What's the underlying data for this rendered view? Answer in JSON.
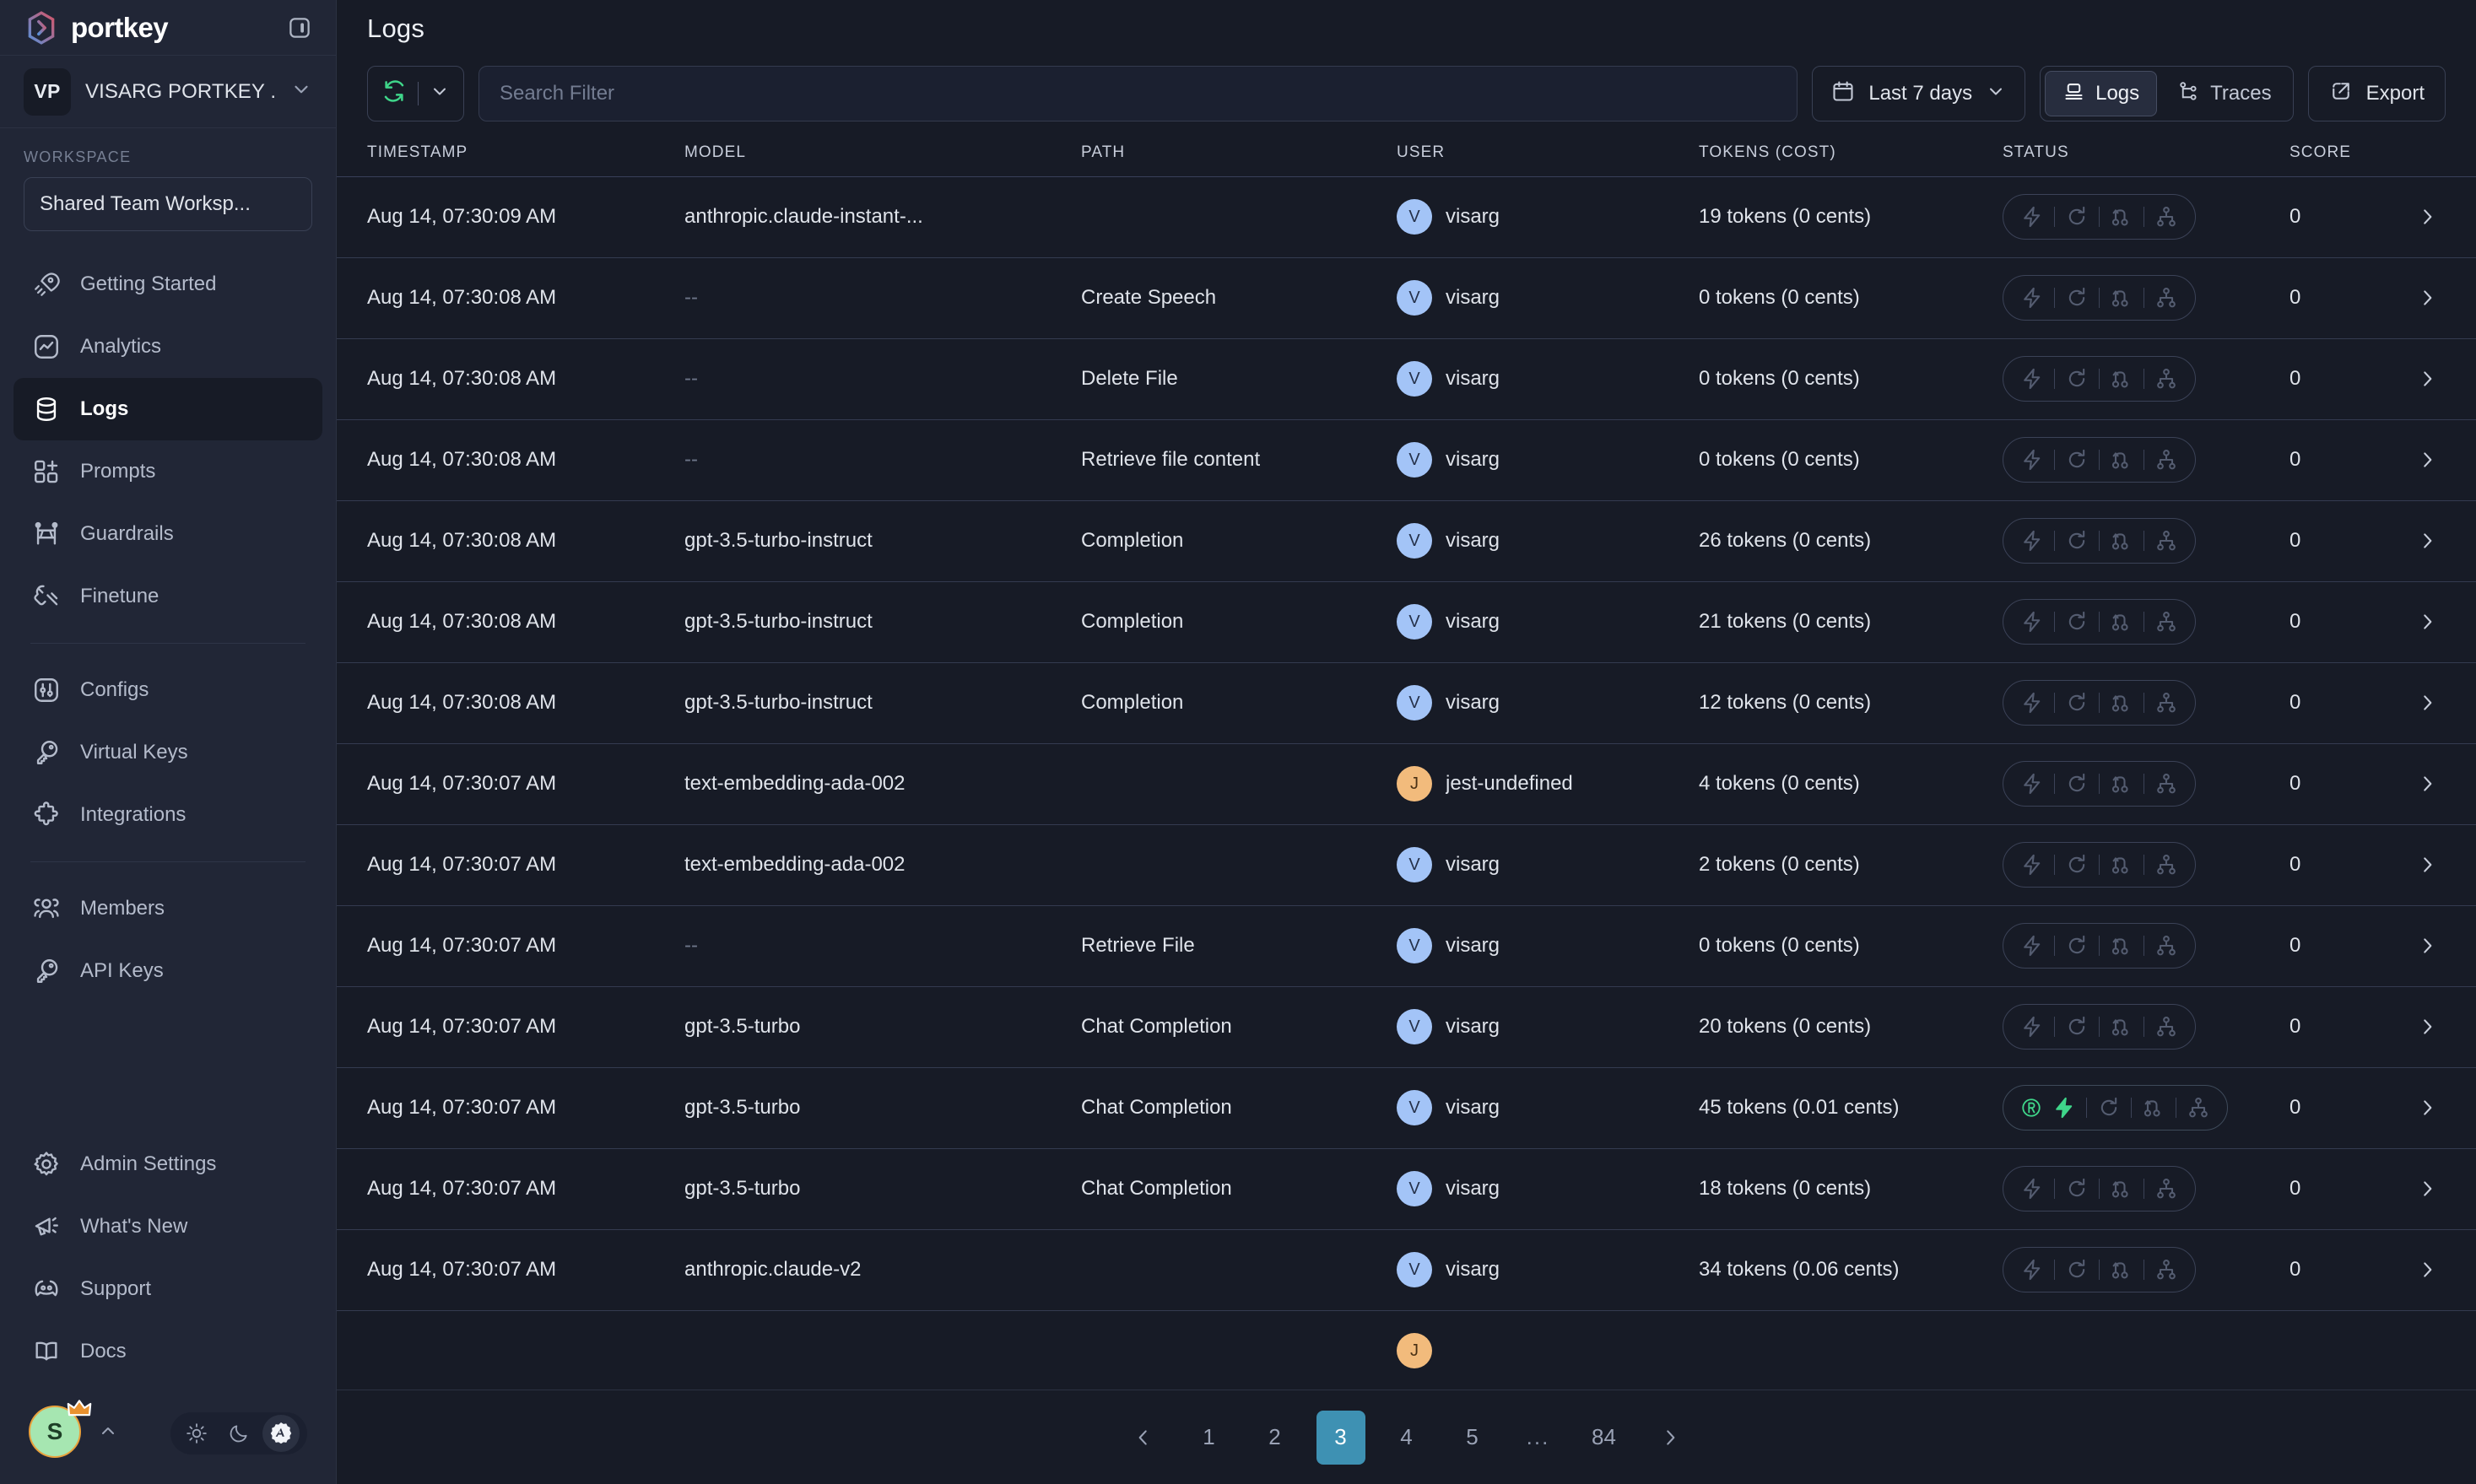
{
  "brand": {
    "name": "portkey",
    "collapse_icon": "panel-collapse-icon"
  },
  "org": {
    "initials": "VP",
    "name": "VISARG PORTKEY ...",
    "caret_icon": "chevron-down-icon"
  },
  "workspace": {
    "label": "WORKSPACE",
    "selected": "Shared Team Worksp...",
    "caret_icon": "chevron-down-icon"
  },
  "sidebar": {
    "nav_primary": [
      {
        "label": "Getting Started",
        "icon": "rocket-icon",
        "active": false
      },
      {
        "label": "Analytics",
        "icon": "analytics-icon",
        "active": false
      },
      {
        "label": "Logs",
        "icon": "database-icon",
        "active": true
      },
      {
        "label": "Prompts",
        "icon": "prompts-icon",
        "active": false
      },
      {
        "label": "Guardrails",
        "icon": "guardrails-icon",
        "active": false
      },
      {
        "label": "Finetune",
        "icon": "wrench-icon",
        "active": false
      }
    ],
    "nav_secondary": [
      {
        "label": "Configs",
        "icon": "sliders-icon",
        "active": false
      },
      {
        "label": "Virtual Keys",
        "icon": "key-icon",
        "active": false
      },
      {
        "label": "Integrations",
        "icon": "puzzle-icon",
        "active": false
      }
    ],
    "nav_tertiary": [
      {
        "label": "Members",
        "icon": "members-icon",
        "active": false
      },
      {
        "label": "API Keys",
        "icon": "key-icon",
        "active": false
      }
    ],
    "nav_bottom": [
      {
        "label": "Admin Settings",
        "icon": "gear-icon",
        "active": false
      },
      {
        "label": "What's New",
        "icon": "megaphone-icon",
        "active": false
      },
      {
        "label": "Support",
        "icon": "discord-icon",
        "active": false
      },
      {
        "label": "Docs",
        "icon": "book-icon",
        "active": false
      }
    ]
  },
  "footer": {
    "user_initial": "S",
    "crown_icon": "crown-icon",
    "caret_icon": "chevron-up-icon",
    "themes": [
      {
        "name": "light-theme",
        "icon": "sun-icon",
        "selected": false
      },
      {
        "name": "dark-theme",
        "icon": "moon-icon",
        "selected": false
      },
      {
        "name": "auto-theme",
        "icon": "auto-badge-icon",
        "selected": true
      }
    ]
  },
  "header": {
    "title": "Logs"
  },
  "toolbar": {
    "refresh_icon": "refresh-icon",
    "refresh_caret_icon": "chevron-down-icon",
    "refresh_color": "#3fd68a",
    "search": {
      "value": "",
      "placeholder": "Search Filter"
    },
    "date_filter": {
      "label": "Last 7 days",
      "icon": "calendar-icon",
      "caret_icon": "chevron-down-icon"
    },
    "view_tabs": [
      {
        "label": "Logs",
        "icon": "logs-icon",
        "selected": true
      },
      {
        "label": "Traces",
        "icon": "traces-icon",
        "selected": false
      }
    ],
    "export": {
      "label": "Export",
      "icon": "external-link-icon"
    }
  },
  "table": {
    "columns": [
      "TIMESTAMP",
      "MODEL",
      "PATH",
      "USER",
      "TOKENS (COST)",
      "STATUS",
      "SCORE"
    ],
    "row_arrow_icon": "chevron-right-icon",
    "status_icons": [
      "lightning-icon",
      "retry-icon",
      "fallback-icon",
      "loadbalance-icon"
    ],
    "rows": [
      {
        "timestamp": "Aug 14, 07:30:09 AM",
        "model": "anthropic.claude-instant-...",
        "path": "",
        "user": "visarg",
        "avatar": "V",
        "avatar_color": "blue",
        "tokens": "19 tokens (0 cents)",
        "score": "0",
        "cache_badge": false
      },
      {
        "timestamp": "Aug 14, 07:30:08 AM",
        "model": "--",
        "path": "Create Speech",
        "user": "visarg",
        "avatar": "V",
        "avatar_color": "blue",
        "tokens": "0 tokens (0 cents)",
        "score": "0",
        "cache_badge": false
      },
      {
        "timestamp": "Aug 14, 07:30:08 AM",
        "model": "--",
        "path": "Delete File",
        "user": "visarg",
        "avatar": "V",
        "avatar_color": "blue",
        "tokens": "0 tokens (0 cents)",
        "score": "0",
        "cache_badge": false
      },
      {
        "timestamp": "Aug 14, 07:30:08 AM",
        "model": "--",
        "path": "Retrieve file content",
        "user": "visarg",
        "avatar": "V",
        "avatar_color": "blue",
        "tokens": "0 tokens (0 cents)",
        "score": "0",
        "cache_badge": false
      },
      {
        "timestamp": "Aug 14, 07:30:08 AM",
        "model": "gpt-3.5-turbo-instruct",
        "path": "Completion",
        "user": "visarg",
        "avatar": "V",
        "avatar_color": "blue",
        "tokens": "26 tokens (0 cents)",
        "score": "0",
        "cache_badge": false
      },
      {
        "timestamp": "Aug 14, 07:30:08 AM",
        "model": "gpt-3.5-turbo-instruct",
        "path": "Completion",
        "user": "visarg",
        "avatar": "V",
        "avatar_color": "blue",
        "tokens": "21 tokens (0 cents)",
        "score": "0",
        "cache_badge": false
      },
      {
        "timestamp": "Aug 14, 07:30:08 AM",
        "model": "gpt-3.5-turbo-instruct",
        "path": "Completion",
        "user": "visarg",
        "avatar": "V",
        "avatar_color": "blue",
        "tokens": "12 tokens (0 cents)",
        "score": "0",
        "cache_badge": false
      },
      {
        "timestamp": "Aug 14, 07:30:07 AM",
        "model": "text-embedding-ada-002",
        "path": "",
        "user": "jest-undefined",
        "avatar": "J",
        "avatar_color": "orange",
        "tokens": "4 tokens (0 cents)",
        "score": "0",
        "cache_badge": false
      },
      {
        "timestamp": "Aug 14, 07:30:07 AM",
        "model": "text-embedding-ada-002",
        "path": "",
        "user": "visarg",
        "avatar": "V",
        "avatar_color": "blue",
        "tokens": "2 tokens (0 cents)",
        "score": "0",
        "cache_badge": false
      },
      {
        "timestamp": "Aug 14, 07:30:07 AM",
        "model": "--",
        "path": "Retrieve File",
        "user": "visarg",
        "avatar": "V",
        "avatar_color": "blue",
        "tokens": "0 tokens (0 cents)",
        "score": "0",
        "cache_badge": false
      },
      {
        "timestamp": "Aug 14, 07:30:07 AM",
        "model": "gpt-3.5-turbo",
        "path": "Chat Completion",
        "user": "visarg",
        "avatar": "V",
        "avatar_color": "blue",
        "tokens": "20 tokens (0 cents)",
        "score": "0",
        "cache_badge": false
      },
      {
        "timestamp": "Aug 14, 07:30:07 AM",
        "model": "gpt-3.5-turbo",
        "path": "Chat Completion",
        "user": "visarg",
        "avatar": "V",
        "avatar_color": "blue",
        "tokens": "45 tokens (0.01 cents)",
        "score": "0",
        "cache_badge": true
      },
      {
        "timestamp": "Aug 14, 07:30:07 AM",
        "model": "gpt-3.5-turbo",
        "path": "Chat Completion",
        "user": "visarg",
        "avatar": "V",
        "avatar_color": "blue",
        "tokens": "18 tokens (0 cents)",
        "score": "0",
        "cache_badge": false
      },
      {
        "timestamp": "Aug 14, 07:30:07 AM",
        "model": "anthropic.claude-v2",
        "path": "",
        "user": "visarg",
        "avatar": "V",
        "avatar_color": "blue",
        "tokens": "34 tokens (0.06 cents)",
        "score": "0",
        "cache_badge": false
      },
      {
        "timestamp": "",
        "model": "",
        "path": "",
        "user": "",
        "avatar": "J",
        "avatar_color": "orange",
        "tokens": "",
        "score": "",
        "cache_badge": false
      }
    ]
  },
  "pagination": {
    "prev_icon": "chevron-left-icon",
    "next_icon": "chevron-right-icon",
    "pages": [
      "1",
      "2",
      "3",
      "4",
      "5",
      "...",
      "84"
    ],
    "current": "3"
  },
  "colors": {
    "accent_green": "#3fd68a",
    "pagination_active": "#3e91b3",
    "sidebar_bg": "#212636",
    "main_bg": "#171b26",
    "avatar_blue": "#a3c4f7",
    "avatar_orange": "#f2bb7c"
  }
}
